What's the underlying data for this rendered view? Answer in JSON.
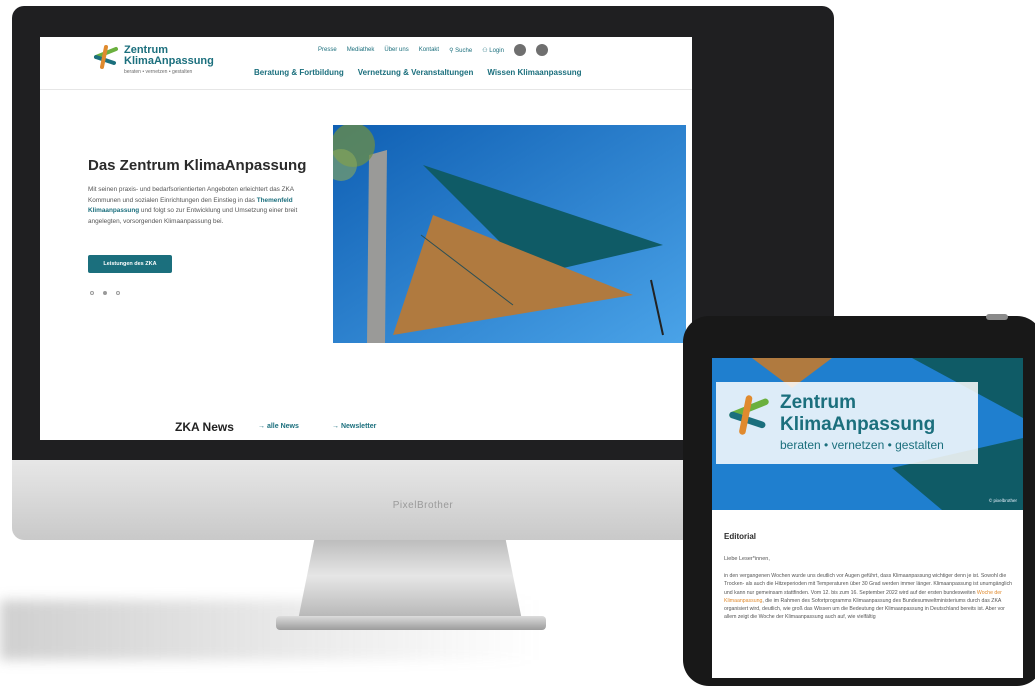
{
  "desktop": {
    "logo": {
      "name_line1": "Zentrum",
      "name_line2": "KlimaAnpassung",
      "tagline": "beraten • vernetzen • gestalten"
    },
    "top_nav": [
      "Presse",
      "Mediathek",
      "Über uns",
      "Kontakt",
      "Suche",
      "Login"
    ],
    "main_nav": [
      "Beratung & Fortbildung",
      "Vernetzung & Veranstaltungen",
      "Wissen Klimaanpassung"
    ],
    "hero": {
      "title": "Das Zentrum KlimaAnpassung",
      "body_1": "Mit seinen praxis- und bedarfsorientierten Angeboten erleichtert das ZKA Kommunen und sozialen Einrichtungen den Einstieg in das ",
      "body_link": "Themenfeld Klimaanpassung",
      "body_2": " und folgt so zur Entwicklung und Umsetzung einer breit angelegten, vorsorgenden Klimaanpassung bei.",
      "button": "Leistungen des ZKA"
    },
    "news": {
      "title": "ZKA News",
      "link_all": "→ alle News",
      "link_newsletter": "→ Newsletter"
    }
  },
  "imac_brand": "PixelBrother",
  "tablet": {
    "logo": {
      "line1": "Zentrum",
      "line2": "KlimaAnpassung",
      "tagline": "beraten • vernetzen • gestalten"
    },
    "photo_credit": "© pixelbrother",
    "editorial_title": "Editorial",
    "greeting": "Liebe Leser*innen,",
    "body_1": "in den vergangenen Wochen wurde uns deutlich vor Augen geführt, dass Klimaanpassung wichtiger denn je ist. Sowohl die Trocken- als auch die Hitzeperioden mit Temperaturen über 30 Grad werden immer länger. Klimaanpassung ist unumgänglich und kann nur gemeinsam stattfinden. Vom 12. bis zum 16. September 2022 wird auf der ersten bundesweiten ",
    "body_highlight": "Woche der Klimaanpassung",
    "body_2": ", die im Rahmen des Sofortprogramms Klimaanpassung des Bundesumweltministeriums durch das ZKA organisiert wird, deutlich, wie groß das Wissen um die Bedeutung der Klimaanpassung in Deutschland bereits ist. Aber vor allem zeigt die Woche der Klimaanpassung auch auf, wie vielfältig"
  },
  "colors": {
    "brand_teal": "#1b6f7d",
    "accent_orange": "#e08a2e",
    "accent_green": "#6bb03e",
    "sky": "#1f7fcf"
  }
}
